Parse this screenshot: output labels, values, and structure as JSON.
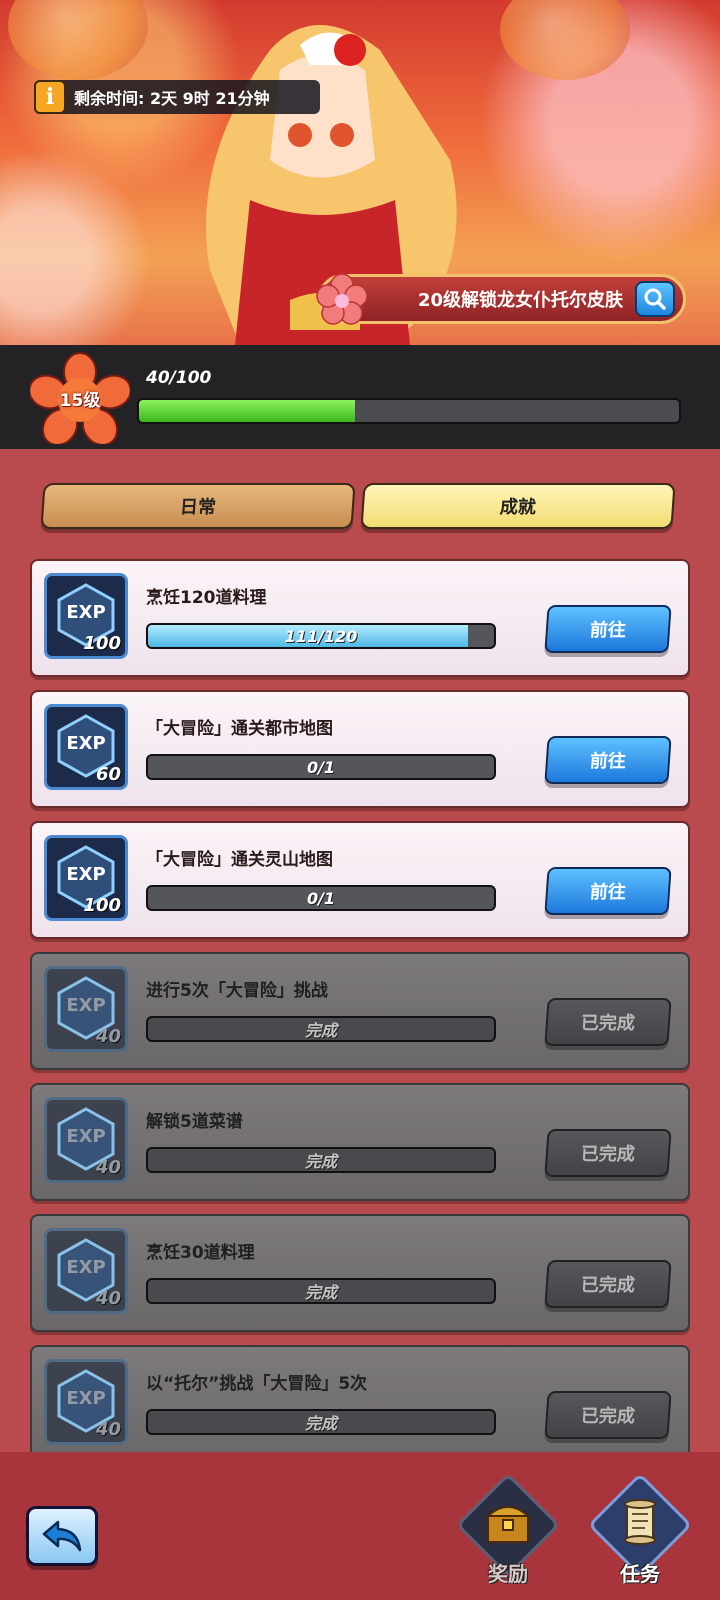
{
  "banner": {
    "timer_text": "剩余时间: 2天 9时 21分钟",
    "unlock_text": "20级解锁龙女仆托尔皮肤"
  },
  "level": {
    "label": "15级",
    "exp_text": "40/100",
    "progress": 0.4
  },
  "tabs": {
    "daily": "日常",
    "achievement": "成就"
  },
  "tasks": [
    {
      "title": "烹饪120道料理",
      "exp_label": "EXP",
      "exp": "100",
      "progress_text": "111/120",
      "progress": 0.925,
      "button": "前往",
      "done": false
    },
    {
      "title": "「大冒险」通关都市地图",
      "exp_label": "EXP",
      "exp": "60",
      "progress_text": "0/1",
      "progress": 0,
      "button": "前往",
      "done": false
    },
    {
      "title": "「大冒险」通关灵山地图",
      "exp_label": "EXP",
      "exp": "100",
      "progress_text": "0/1",
      "progress": 0,
      "button": "前往",
      "done": false
    },
    {
      "title": "进行5次「大冒险」挑战",
      "exp_label": "EXP",
      "exp": "40",
      "progress_text": "完成",
      "progress": 1,
      "button": "已完成",
      "done": true
    },
    {
      "title": "解锁5道菜谱",
      "exp_label": "EXP",
      "exp": "40",
      "progress_text": "完成",
      "progress": 1,
      "button": "已完成",
      "done": true
    },
    {
      "title": "烹饪30道料理",
      "exp_label": "EXP",
      "exp": "40",
      "progress_text": "完成",
      "progress": 1,
      "button": "已完成",
      "done": true
    },
    {
      "title": "以“托尔”挑战「大冒险」5次",
      "exp_label": "EXP",
      "exp": "40",
      "progress_text": "完成",
      "progress": 1,
      "button": "已完成",
      "done": true
    }
  ],
  "nav": {
    "rewards": "奖励",
    "tasks": "任务",
    "rewards_icon": "treasure-chest-icon",
    "tasks_icon": "scroll-icon",
    "back_icon": "back-arrow-icon"
  },
  "colors": {
    "accent_blue": "#1d78dc",
    "progress_green": "#3bb81e",
    "background_red": "#b94a4e"
  }
}
